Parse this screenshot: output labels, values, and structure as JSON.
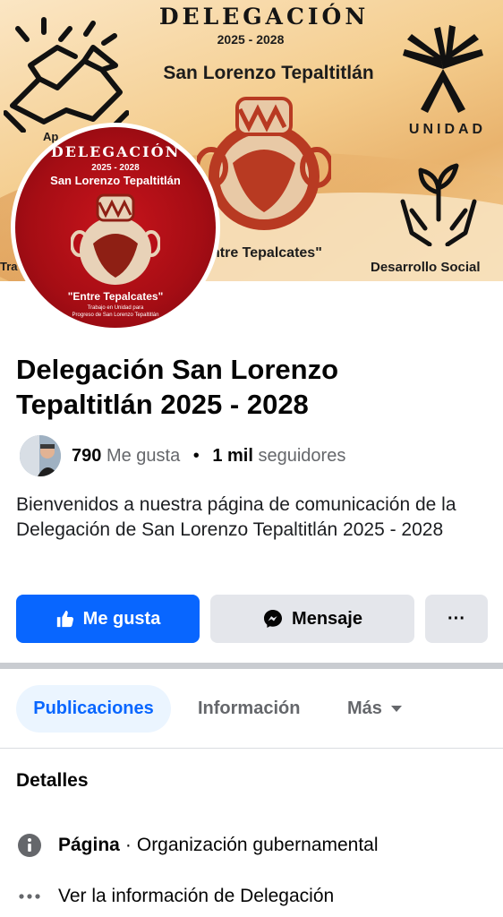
{
  "cover": {
    "title": "DELEGACIÓN",
    "years": "2025 - 2028",
    "place": "San Lorenzo Tepaltitlán",
    "unidad": "UNIDAD",
    "entre": "ntre Tepalcates\"",
    "desarrollo": "Desarrollo Social",
    "partial_left": "Ap",
    "partial_bottom": "Tra"
  },
  "avatar": {
    "title": "DELEGACIÓN",
    "years": "2025 - 2028",
    "place": "San Lorenzo Tepaltitlán",
    "entre": "\"Entre Tepalcates\"",
    "sub1": "Trabajo en Unidad para",
    "sub2": "Progreso de San Lorenzo Tepaltitlán"
  },
  "page": {
    "name": "Delegación San Lorenzo Tepaltitlán 2025 - 2028",
    "likes_count": "790",
    "likes_label": "Me gusta",
    "separator": "•",
    "followers_count": "1 mil",
    "followers_label": "seguidores",
    "description": "Bienvenidos a nuestra página de comunicación de la Delegación de San Lorenzo Tepaltitlán 2025 - 2028"
  },
  "actions": {
    "like_label": "Me gusta",
    "message_label": "Mensaje",
    "more_label": "···"
  },
  "tabs": [
    {
      "label": "Publicaciones",
      "active": true
    },
    {
      "label": "Información",
      "active": false
    },
    {
      "label": "Más",
      "active": false
    }
  ],
  "details": {
    "title": "Detalles",
    "category_label": "Página",
    "category_sep": "·",
    "category_value": "Organización gubernamental",
    "more_info": "Ver la información de Delegación"
  },
  "colors": {
    "accent": "#0866ff",
    "secondary_button": "#e4e6eb",
    "active_tab_bg": "#ebf5ff",
    "muted_text": "#65676b",
    "avatar_red": "#c8141c"
  },
  "icons": [
    "handshake-icon",
    "hands-together-icon",
    "hands-plant-icon",
    "vase-image",
    "thumbs-up-icon",
    "messenger-icon",
    "more-dots-icon",
    "caret-down-icon",
    "info-icon",
    "ellipsis-icon"
  ]
}
